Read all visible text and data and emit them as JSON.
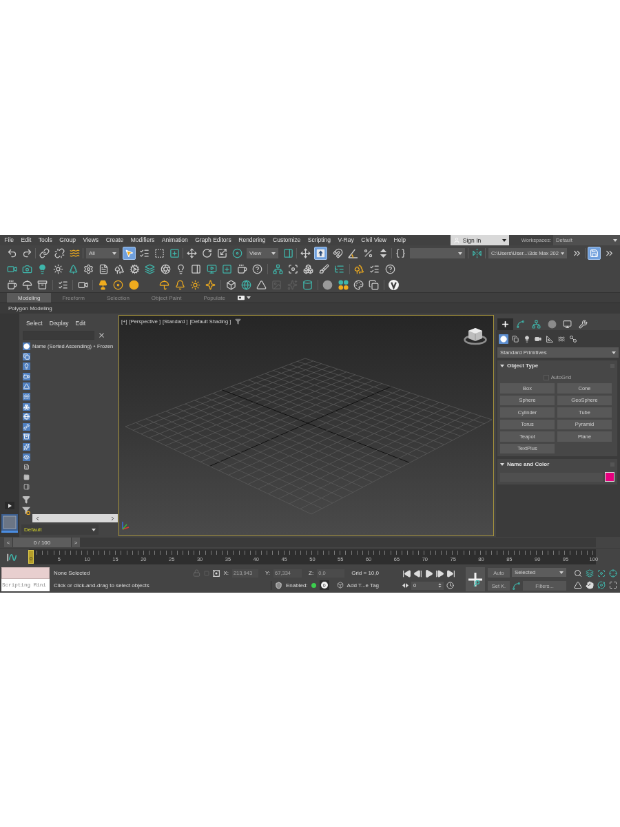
{
  "menu_bar": {
    "items": [
      "File",
      "Edit",
      "Tools",
      "Group",
      "Views",
      "Create",
      "Modifiers",
      "Animation",
      "Graph Editors",
      "Rendering",
      "Customize",
      "Scripting",
      "V-Ray",
      "Civil View",
      "Help"
    ],
    "sign_in": "Sign In",
    "workspaces_label": "Workspaces:",
    "workspace": "Default"
  },
  "main_toolbar": {
    "selection_filter": "All",
    "select_object": {
      "on": true
    },
    "coordinate_system": "View",
    "keyboard_override": {
      "on": true
    },
    "project_folder": "C:\\Users\\User...\\3ds Max 202",
    "auto_backup": {
      "on": true
    }
  },
  "ribbon": {
    "tabs": [
      {
        "label": "Modeling",
        "selected": true
      },
      {
        "label": "Freeform",
        "selected": false
      },
      {
        "label": "Selection",
        "selected": false
      },
      {
        "label": "Object Paint",
        "selected": false
      },
      {
        "label": "Populate",
        "selected": false
      }
    ],
    "panel": "Polygon Modeling"
  },
  "scene_explorer": {
    "menu": [
      "Select",
      "Display",
      "Edit"
    ],
    "columns": [
      "Name (Sorted Ascending)",
      "Frozen"
    ],
    "filters": [
      {
        "on": true
      },
      {
        "on": true
      },
      {
        "on": true
      },
      {
        "on": true
      },
      {
        "on": true
      },
      {
        "on": true
      },
      {
        "on": true
      },
      {
        "on": true
      },
      {
        "on": true
      },
      {
        "on": true
      },
      {
        "on": true
      },
      {
        "on": true
      },
      {
        "on": false
      },
      {
        "on": false
      },
      {
        "on": false
      }
    ],
    "layer": "Default"
  },
  "viewport": {
    "labels": [
      "[+]",
      "[Perspective ]",
      "[Standard ]",
      "[Default Shading ]"
    ],
    "active": true
  },
  "command_panel": {
    "tabs": [
      {
        "selected": true
      },
      {
        "selected": false
      },
      {
        "selected": false
      },
      {
        "selected": false
      },
      {
        "selected": false
      },
      {
        "selected": false
      }
    ],
    "categories": [
      {
        "selected": true
      },
      {
        "selected": false
      },
      {
        "selected": false
      },
      {
        "selected": false
      },
      {
        "selected": false
      },
      {
        "selected": false
      },
      {
        "selected": false
      }
    ],
    "object_category": "Standard Primitives",
    "rollouts": [
      {
        "kind": "object_type",
        "title": "Object Type",
        "expanded": true,
        "autogrid": {
          "label": "AutoGrid",
          "checked": false,
          "disabled": true
        },
        "buttons": [
          "Box",
          "Cone",
          "Sphere",
          "GeoSphere",
          "Cylinder",
          "Tube",
          "Torus",
          "Pyramid",
          "Teapot",
          "Plane",
          "TextPlus"
        ]
      },
      {
        "kind": "name_color",
        "title": "Name and Color",
        "expanded": true,
        "color": "#e6007e"
      }
    ]
  },
  "time_slider": {
    "previous": "<",
    "frame": "0 / 100",
    "next": ">",
    "level": 0
  },
  "track_bar": {
    "ticks": [
      {
        "label": "0",
        "selected": true
      },
      {
        "label": "5",
        "selected": false
      },
      {
        "label": "10",
        "selected": false
      },
      {
        "label": "15",
        "selected": false
      },
      {
        "label": "20",
        "selected": false
      },
      {
        "label": "25",
        "selected": false
      },
      {
        "label": "30",
        "selected": false
      },
      {
        "label": "35",
        "selected": false
      },
      {
        "label": "40",
        "selected": false
      },
      {
        "label": "45",
        "selected": false
      },
      {
        "label": "50",
        "selected": false
      },
      {
        "label": "55",
        "selected": false
      },
      {
        "label": "60",
        "selected": false
      },
      {
        "label": "65",
        "selected": false
      },
      {
        "label": "70",
        "selected": false
      },
      {
        "label": "75",
        "selected": false
      },
      {
        "label": "80",
        "selected": false
      },
      {
        "label": "85",
        "selected": false
      },
      {
        "label": "90",
        "selected": false
      },
      {
        "label": "95",
        "selected": false
      },
      {
        "label": "100",
        "selected": false
      }
    ]
  },
  "status_bar": {
    "listener": "Scripting Mini",
    "selection": "None Selected",
    "prompt": "Click or click-and-drag to select objects",
    "coordinates": [
      {
        "axis": "X:",
        "value": "213,943",
        "disabled": true
      },
      {
        "axis": "Y:",
        "value": "67,334",
        "disabled": true
      },
      {
        "axis": "Z:",
        "value": "0,0",
        "disabled": true
      }
    ],
    "grid": "Grid = 10,0",
    "adaptive": {
      "label": "Enabled:",
      "on": true
    },
    "degradation": "0",
    "tag": "Add T...e Tag"
  },
  "playback": {
    "frame": "0"
  },
  "key_controls": {
    "auto": "Auto",
    "set_key": "Set K.",
    "key_filter": "Selected",
    "filters": "Filters..."
  }
}
